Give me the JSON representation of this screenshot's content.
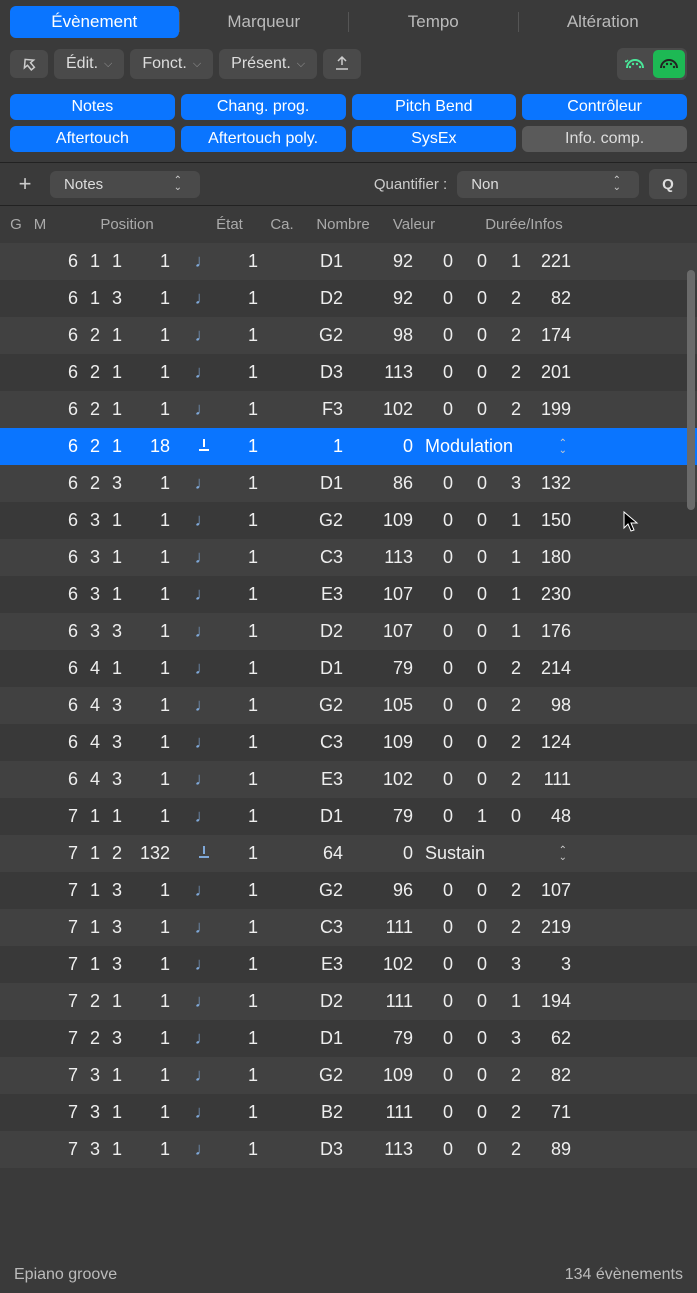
{
  "tabs": [
    "Évènement",
    "Marqueur",
    "Tempo",
    "Altération"
  ],
  "toolbar": {
    "edit": "Édit.",
    "funct": "Fonct.",
    "present": "Présent."
  },
  "filters": [
    "Notes",
    "Chang. prog.",
    "Pitch Bend",
    "Contrôleur",
    "Aftertouch",
    "Aftertouch poly.",
    "SysEx",
    "Info. comp."
  ],
  "addrow": {
    "type": "Notes",
    "quant_label": "Quantifier :",
    "quant_value": "Non",
    "q": "Q"
  },
  "columns": {
    "g": "G",
    "m": "M",
    "pos": "Position",
    "etat": "État",
    "ca": "Ca.",
    "num": "Nombre",
    "val": "Valeur",
    "dur": "Durée/Infos"
  },
  "events": [
    {
      "p": [
        "6",
        "1",
        "1",
        "1"
      ],
      "ca": "1",
      "n": "D1",
      "v": "92",
      "d": [
        "0",
        "0",
        "1",
        "221"
      ],
      "type": "note"
    },
    {
      "p": [
        "6",
        "1",
        "3",
        "1"
      ],
      "ca": "1",
      "n": "D2",
      "v": "92",
      "d": [
        "0",
        "0",
        "2",
        "82"
      ],
      "type": "note"
    },
    {
      "p": [
        "6",
        "2",
        "1",
        "1"
      ],
      "ca": "1",
      "n": "G2",
      "v": "98",
      "d": [
        "0",
        "0",
        "2",
        "174"
      ],
      "type": "note"
    },
    {
      "p": [
        "6",
        "2",
        "1",
        "1"
      ],
      "ca": "1",
      "n": "D3",
      "v": "113",
      "d": [
        "0",
        "0",
        "2",
        "201"
      ],
      "type": "note"
    },
    {
      "p": [
        "6",
        "2",
        "1",
        "1"
      ],
      "ca": "1",
      "n": "F3",
      "v": "102",
      "d": [
        "0",
        "0",
        "2",
        "199"
      ],
      "type": "note"
    },
    {
      "p": [
        "6",
        "2",
        "1",
        "18"
      ],
      "ca": "1",
      "n": "1",
      "v": "0",
      "info": "Modulation",
      "type": "ctrl",
      "selected": true
    },
    {
      "p": [
        "6",
        "2",
        "3",
        "1"
      ],
      "ca": "1",
      "n": "D1",
      "v": "86",
      "d": [
        "0",
        "0",
        "3",
        "132"
      ],
      "type": "note"
    },
    {
      "p": [
        "6",
        "3",
        "1",
        "1"
      ],
      "ca": "1",
      "n": "G2",
      "v": "109",
      "d": [
        "0",
        "0",
        "1",
        "150"
      ],
      "type": "note"
    },
    {
      "p": [
        "6",
        "3",
        "1",
        "1"
      ],
      "ca": "1",
      "n": "C3",
      "v": "113",
      "d": [
        "0",
        "0",
        "1",
        "180"
      ],
      "type": "note"
    },
    {
      "p": [
        "6",
        "3",
        "1",
        "1"
      ],
      "ca": "1",
      "n": "E3",
      "v": "107",
      "d": [
        "0",
        "0",
        "1",
        "230"
      ],
      "type": "note"
    },
    {
      "p": [
        "6",
        "3",
        "3",
        "1"
      ],
      "ca": "1",
      "n": "D2",
      "v": "107",
      "d": [
        "0",
        "0",
        "1",
        "176"
      ],
      "type": "note"
    },
    {
      "p": [
        "6",
        "4",
        "1",
        "1"
      ],
      "ca": "1",
      "n": "D1",
      "v": "79",
      "d": [
        "0",
        "0",
        "2",
        "214"
      ],
      "type": "note"
    },
    {
      "p": [
        "6",
        "4",
        "3",
        "1"
      ],
      "ca": "1",
      "n": "G2",
      "v": "105",
      "d": [
        "0",
        "0",
        "2",
        "98"
      ],
      "type": "note"
    },
    {
      "p": [
        "6",
        "4",
        "3",
        "1"
      ],
      "ca": "1",
      "n": "C3",
      "v": "109",
      "d": [
        "0",
        "0",
        "2",
        "124"
      ],
      "type": "note"
    },
    {
      "p": [
        "6",
        "4",
        "3",
        "1"
      ],
      "ca": "1",
      "n": "E3",
      "v": "102",
      "d": [
        "0",
        "0",
        "2",
        "111"
      ],
      "type": "note"
    },
    {
      "p": [
        "7",
        "1",
        "1",
        "1"
      ],
      "ca": "1",
      "n": "D1",
      "v": "79",
      "d": [
        "0",
        "1",
        "0",
        "48"
      ],
      "type": "note"
    },
    {
      "p": [
        "7",
        "1",
        "2",
        "132"
      ],
      "ca": "1",
      "n": "64",
      "v": "0",
      "info": "Sustain",
      "type": "ctrl"
    },
    {
      "p": [
        "7",
        "1",
        "3",
        "1"
      ],
      "ca": "1",
      "n": "G2",
      "v": "96",
      "d": [
        "0",
        "0",
        "2",
        "107"
      ],
      "type": "note"
    },
    {
      "p": [
        "7",
        "1",
        "3",
        "1"
      ],
      "ca": "1",
      "n": "C3",
      "v": "111",
      "d": [
        "0",
        "0",
        "2",
        "219"
      ],
      "type": "note"
    },
    {
      "p": [
        "7",
        "1",
        "3",
        "1"
      ],
      "ca": "1",
      "n": "E3",
      "v": "102",
      "d": [
        "0",
        "0",
        "3",
        "3"
      ],
      "type": "note"
    },
    {
      "p": [
        "7",
        "2",
        "1",
        "1"
      ],
      "ca": "1",
      "n": "D2",
      "v": "111",
      "d": [
        "0",
        "0",
        "1",
        "194"
      ],
      "type": "note"
    },
    {
      "p": [
        "7",
        "2",
        "3",
        "1"
      ],
      "ca": "1",
      "n": "D1",
      "v": "79",
      "d": [
        "0",
        "0",
        "3",
        "62"
      ],
      "type": "note"
    },
    {
      "p": [
        "7",
        "3",
        "1",
        "1"
      ],
      "ca": "1",
      "n": "G2",
      "v": "109",
      "d": [
        "0",
        "0",
        "2",
        "82"
      ],
      "type": "note"
    },
    {
      "p": [
        "7",
        "3",
        "1",
        "1"
      ],
      "ca": "1",
      "n": "B2",
      "v": "111",
      "d": [
        "0",
        "0",
        "2",
        "71"
      ],
      "type": "note"
    },
    {
      "p": [
        "7",
        "3",
        "1",
        "1"
      ],
      "ca": "1",
      "n": "D3",
      "v": "113",
      "d": [
        "0",
        "0",
        "2",
        "89"
      ],
      "type": "note"
    }
  ],
  "footer": {
    "region": "Epiano groove",
    "count": "134 évènements"
  }
}
